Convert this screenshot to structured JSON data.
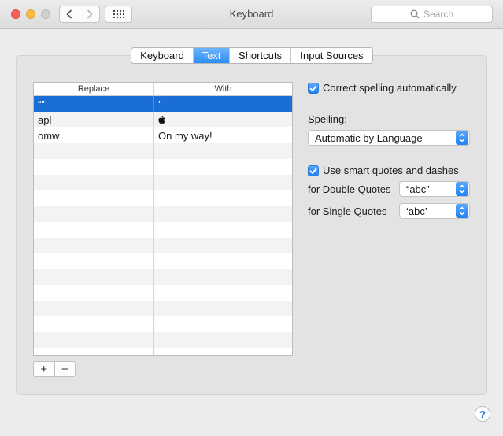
{
  "window": {
    "title": "Keyboard"
  },
  "toolbar": {
    "search_placeholder": "Search"
  },
  "tabs": [
    {
      "label": "Keyboard",
      "active": false
    },
    {
      "label": "Text",
      "active": true
    },
    {
      "label": "Shortcuts",
      "active": false
    },
    {
      "label": "Input Sources",
      "active": false
    }
  ],
  "table": {
    "columns": [
      "Replace",
      "With"
    ],
    "rows": [
      {
        "replace": "“”",
        "with": "’",
        "selected": true
      },
      {
        "replace": "apl",
        "with": "",
        "selected": false
      },
      {
        "replace": "omw",
        "with": "On my way!",
        "selected": false
      }
    ]
  },
  "controls": {
    "add_label": "+",
    "remove_label": "−",
    "correct_spelling": {
      "label": "Correct spelling automatically",
      "checked": true
    },
    "spelling_label": "Spelling:",
    "spelling_value": "Automatic by Language",
    "smart_quotes": {
      "label": "Use smart quotes and dashes",
      "checked": true
    },
    "double_quotes_label": "for Double Quotes",
    "double_quotes_value": "“abc”",
    "single_quotes_label": "for Single Quotes",
    "single_quotes_value": "‘abc’",
    "help_label": "?"
  },
  "colors": {
    "accent": "#1c6ed7",
    "close": "#fc605c",
    "minimize": "#fdbc40",
    "zoom": "#cfcfcf"
  }
}
